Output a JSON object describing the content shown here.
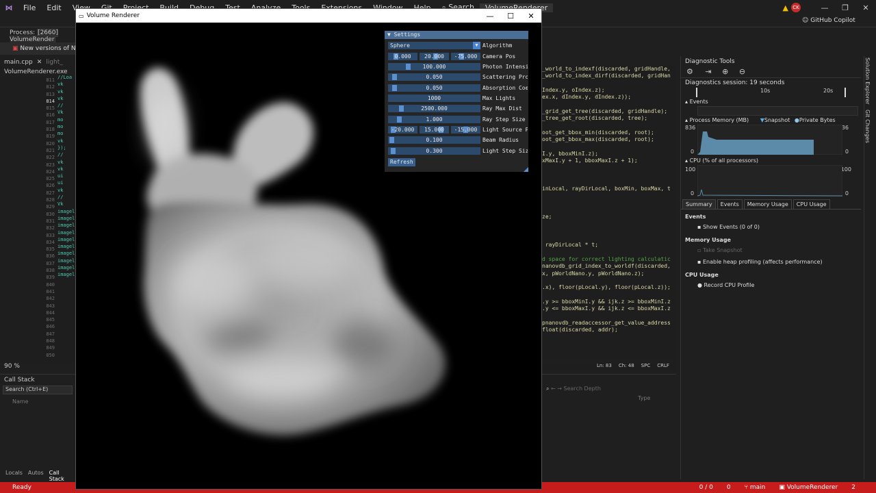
{
  "menu": [
    "File",
    "Edit",
    "View",
    "Git",
    "Project",
    "Build",
    "Debug",
    "Test",
    "Analyze",
    "Tools",
    "Extensions",
    "Window",
    "Help"
  ],
  "search_label": "Search",
  "solution_name": "VolumeRenderer",
  "user_initials": "CK",
  "copilot_label": "GitHub Copilot",
  "process_label": "Process:",
  "process_value": "[2660] VolumeRender",
  "info_message": "New versions of NVIDIA to",
  "file_tabs": [
    "main.cpp",
    "light_",
    "VolumeRenderer.exe"
  ],
  "editor_partial_lines": [
    "//Loa",
    "vk",
    "vk",
    "vk",
    "//",
    "Vk",
    "mo",
    "mo",
    "mo",
    "vk",
    "});",
    "//",
    "vk",
    "vk",
    "ui",
    "ui",
    "vk",
    "//",
    "Vk",
    "imagel",
    "imagel",
    "imagel",
    "imagel",
    "imagel",
    "imagel",
    "imagel",
    "imagel",
    "imagel",
    "imagel"
  ],
  "line_numbers": [
    "811",
    "812",
    "813",
    "814",
    "815",
    "816",
    "817",
    "818",
    "819",
    "820",
    "821",
    "822",
    "823",
    "824",
    "825",
    "826",
    "827",
    "828",
    "829",
    "830",
    "831",
    "832",
    "833",
    "834",
    "835",
    "836",
    "837",
    "838",
    "839",
    "840",
    "841",
    "842",
    "843",
    "844",
    "845",
    "846",
    "847",
    "848",
    "849",
    "850"
  ],
  "current_line": "814",
  "zoom_level": "90 %",
  "call_stack": {
    "title": "Call Stack",
    "search_placeholder": "Search (Ctrl+E)",
    "col_name": "Name"
  },
  "bottom_tabs": [
    "Locals",
    "Autos",
    "Call Stack"
  ],
  "status_ready": "Ready",
  "status_right": {
    "errors": "0 / 0",
    "warnings": "0",
    "branch": "main",
    "repo": "VolumeRenderer",
    "notif": "2"
  },
  "renderer": {
    "title": "Volume Renderer",
    "settings": {
      "title": "Settings",
      "algorithm": {
        "value": "Sphere",
        "label": "Algorithm"
      },
      "camera_pos": {
        "values": [
          "0.000",
          "20.000",
          "-75.000"
        ],
        "label": "Camera Pos"
      },
      "photon_intensity": {
        "value": "100.000",
        "label": "Photon Intensi"
      },
      "scattering": {
        "value": "0.050",
        "label": "Scattering Pro"
      },
      "absorption": {
        "value": "0.050",
        "label": "Absorption Coe"
      },
      "max_lights": {
        "value": "1000",
        "label": "Max Lights"
      },
      "ray_max_dist": {
        "value": "2500.000",
        "label": "Ray Max Dist"
      },
      "ray_step_size": {
        "value": "1.000",
        "label": "Ray Step Size"
      },
      "light_source_pos": {
        "values": [
          "-20.000",
          "15.000",
          "-15.000"
        ],
        "label": "Light Source P"
      },
      "beam_radius": {
        "value": "0.100",
        "label": "Beam Radius"
      },
      "light_step_size": {
        "value": "0.300",
        "label": "Light Step Siz"
      },
      "refresh_label": "Refresh"
    }
  },
  "code_right": [
    "_world_to_indexf(discarded, gridHandle,",
    "_world_to_index_dirf(discarded, gridHan",
    "",
    "Index.y, oIndex.z);",
    "ex.x, dIndex.y, dIndex.z));",
    "",
    "_grid_get_tree(discarded, gridHandle);",
    "_tree_get_root(discarded, tree);",
    "",
    "oot_get_bbox_min(discarded, root);",
    "oot_get_bbox_max(discarded, root);",
    "",
    "I.y, bboxMinI.z);",
    "xMaxI.y + 1, bboxMaxI.z + 1);",
    "",
    "",
    "",
    "inLocal, rayDirLocal, boxMin, boxMax, t",
    "",
    "",
    "",
    "ze;",
    "",
    "",
    "",
    " rayDirLocal * t;",
    "",
    "d space for correct lighting calculatic",
    "nanovdb_grid_index_to_worldf(discarded,",
    "x, pWorldNano.y, pWorldNano.z);",
    "",
    ".x), floor(pLocal.y), floor(pLocal.z));",
    "",
    ".y >= bboxMinI.y && ijk.z >= bboxMinI.z",
    ".y <= bboxMaxI.y && ijk.z <= bboxMaxI.z",
    "",
    "pnanovdb_readaccessor_get_value_address",
    "float(discarded, addr);"
  ],
  "code_status": {
    "ln": "Ln: 83",
    "ch": "Ch: 48",
    "spc": "SPC",
    "crlf": "CRLF"
  },
  "lower_panel": {
    "search_depth": "Search Depth",
    "col_type": "Type"
  },
  "diagnostics": {
    "title": "Diagnostic Tools",
    "session": "Diagnostics session: 19 seconds",
    "timeline": [
      "10s",
      "20s"
    ],
    "events_label": "Events",
    "memory_label": "Process Memory (MB)",
    "snapshot_label": "Snapshot",
    "private_bytes_label": "Private Bytes",
    "mem_max": "836",
    "mem_min": "0",
    "cpu_label": "CPU (% of all processors)",
    "cpu_max": "100",
    "cpu_min": "0",
    "tabs": [
      "Summary",
      "Events",
      "Memory Usage",
      "CPU Usage"
    ],
    "summary": {
      "events_header": "Events",
      "show_events": "Show Events (0 of 0)",
      "memory_header": "Memory Usage",
      "take_snapshot": "Take Snapshot",
      "heap_profiling": "Enable heap profiling (affects performance)",
      "cpu_header": "CPU Usage",
      "record_cpu": "Record CPU Profile"
    }
  },
  "side_rail": [
    "Solution Explorer",
    "Git Changes"
  ]
}
